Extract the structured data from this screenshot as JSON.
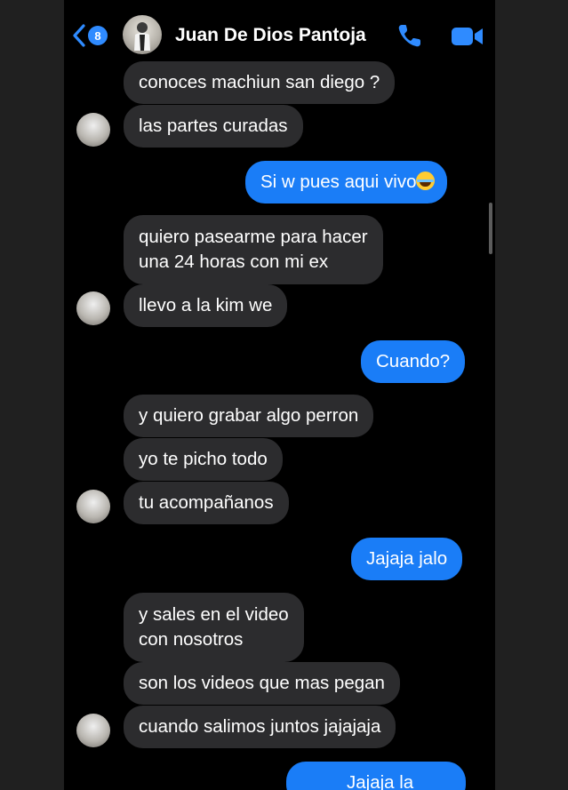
{
  "header": {
    "back_badge": "8",
    "contact_name": "Juan De Dios Pantoja"
  },
  "messages": [
    {
      "text": "conoces machiun san diego ?"
    },
    {
      "text": "las partes curadas"
    },
    {
      "text": "Si w pues aqui vivo"
    },
    {
      "line1": "quiero pasearme para hacer",
      "line2": "una 24 horas con mi ex"
    },
    {
      "text": "llevo a la kim we"
    },
    {
      "text": "Cuando?"
    },
    {
      "text": "y quiero grabar algo perron"
    },
    {
      "text": "yo te picho todo"
    },
    {
      "text": "tu acompañanos"
    },
    {
      "text": "Jajaja jalo"
    },
    {
      "line1": "y sales en el video",
      "line2": "con nosotros"
    },
    {
      "text": "son los videos que mas pegan"
    },
    {
      "text": "cuando salimos juntos jajajaja"
    },
    {
      "text": "Jajaja la"
    }
  ],
  "icons": {
    "back": "chevron-left-icon",
    "phone": "phone-icon",
    "video": "video-camera-icon",
    "emoji": "laughing-tears-emoji"
  },
  "colors": {
    "incoming_bubble": "#2c2c2e",
    "outgoing_bubble": "#1a7df7",
    "accent": "#2f8bff",
    "background": "#000000"
  }
}
